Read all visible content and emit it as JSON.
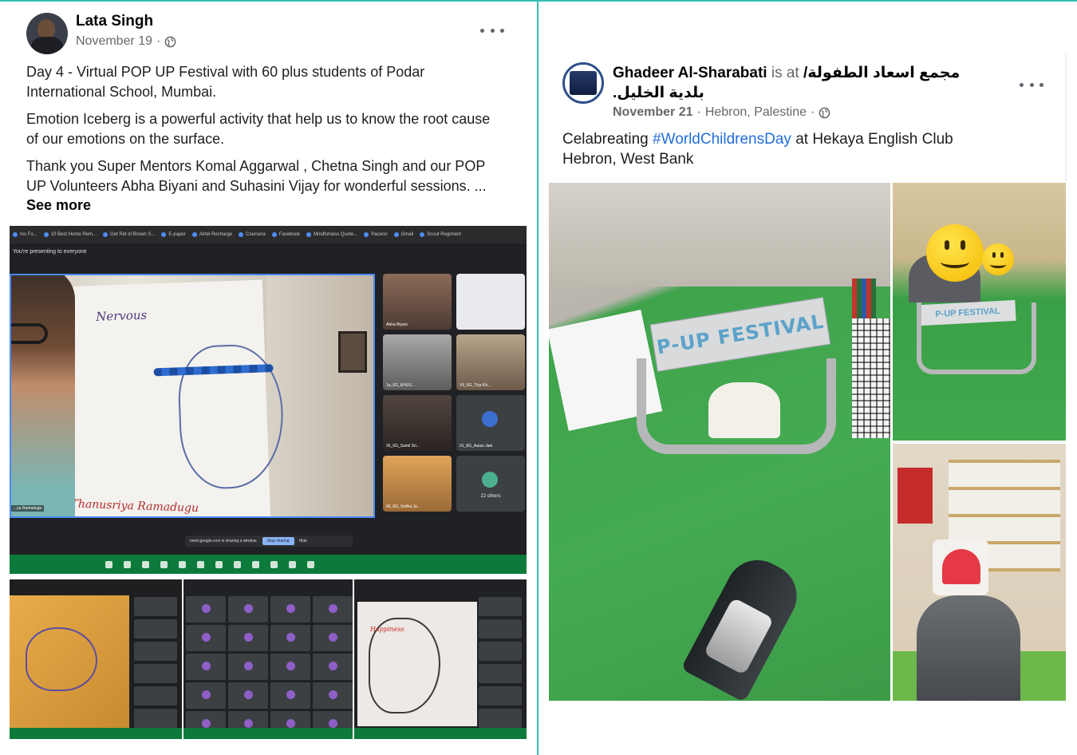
{
  "left_post": {
    "author": "Lata Singh",
    "date": "November 19",
    "meta_separator": "·",
    "paragraph1": "Day 4 - Virtual POP UP Festival with 60 plus students of Podar International School, Mumbai.",
    "paragraph2": "Emotion Iceberg is a powerful activity that help us to know the root cause of our emotions on the surface.",
    "paragraph3": "Thank you Super Mentors Komal Aggarwal , Chetna Singh  and our POP UP Volunteers Abha Biyani and Suhasini Vijay for wonderful sessions. ...",
    "see_more": "See more",
    "screenshot": {
      "bookmarks": [
        "Ins Fo...",
        "10 Best Home Rem...",
        "Get Rid of Brown S...",
        "E-paper",
        "Airtel Recharge",
        "Coursera",
        "Facebook",
        "Mindfulness Quote...",
        "Paceon",
        "Gmail",
        "Scout Regiment"
      ],
      "presenting_text": "You're presenting to everyone",
      "drawing_word": "Nervous",
      "signature": "Thanusriya Ramadugu",
      "presenter_label": "...ya Ramadugu",
      "tile_labels": [
        "Abha Biyani",
        "",
        "1a_6G_KHUS...",
        "VII_6G_Tiya Kh...",
        "26_6G_Samil Sri...",
        "01_6G_Aarav Jain",
        "06_6G_Vedha Ja...",
        "22 others"
      ],
      "share_text": "meet.google.com is sharing a window.",
      "stop_sharing": "Stop sharing",
      "hide": "Hide"
    }
  },
  "right_post": {
    "author": "Ghadeer Al-Sharabati",
    "is_at": "is at",
    "place": "مجمع اسعاد الطفولة/ بلدية الخليل.",
    "date": "November 21",
    "location": "Hebron, Palestine",
    "text_before": "Celabreating ",
    "hashtag": "#WorldChildrensDay",
    "text_after": " at Hekaya English Club Hebron, West Bank",
    "photo_banner": "P-UP FESTIVAL",
    "photo_banner_small": "P-UP FESTIVAL"
  },
  "colors": {
    "divider": "#35bdb6",
    "link": "#216fdb",
    "meta": "#65676b"
  },
  "icons": [
    "globe-icon",
    "more-options-icon"
  ]
}
